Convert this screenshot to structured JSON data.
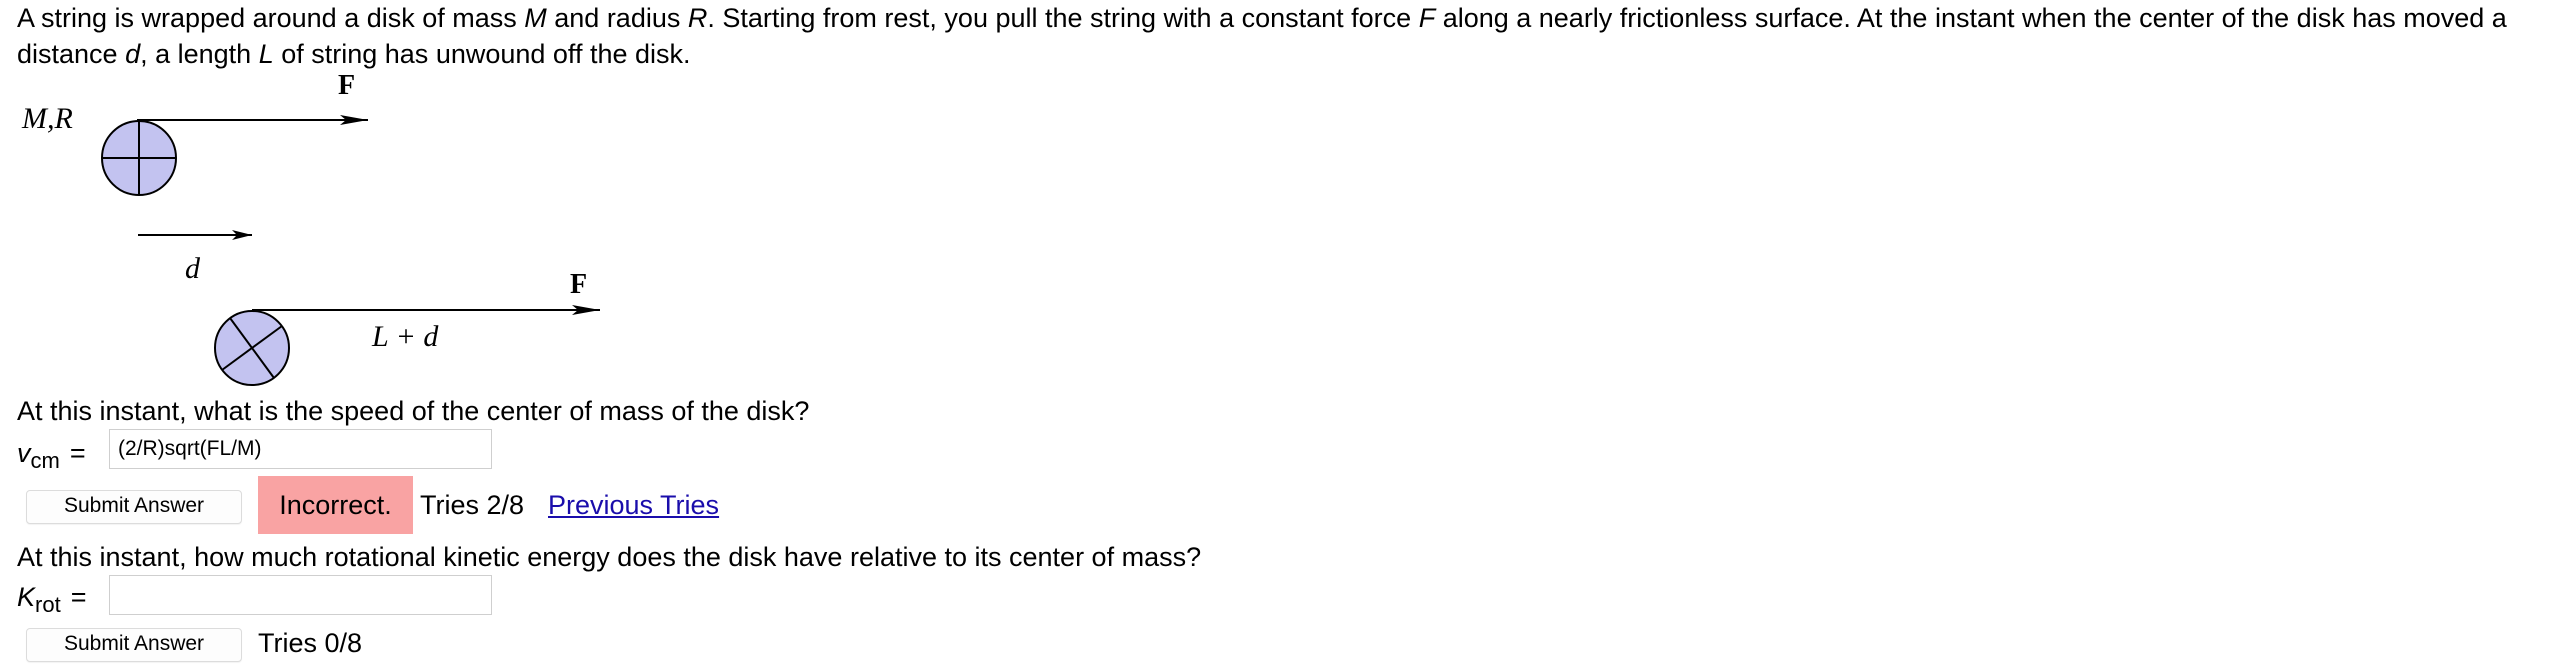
{
  "problem": {
    "p1": "A string is wrapped around a disk of mass ",
    "M": "M",
    "p2": " and radius ",
    "R": "R",
    "p3": ". Starting from rest, you pull the string with a constant force ",
    "F": "F",
    "p4": " along a nearly frictionless surface. At the instant when the center of the disk has moved a distance ",
    "d": "d",
    "p5": ", a length ",
    "L": "L",
    "p6": " of string has unwound off the disk."
  },
  "diagram": {
    "label_mr": "M,R",
    "label_f_top": "F",
    "label_d": "d",
    "label_f_bottom": "F",
    "label_ld": "L + d",
    "disk_color": "#c3c3f0"
  },
  "question1": {
    "prompt": "At this instant, what is the speed of the center of mass of the disk?",
    "var_symbol": "v",
    "var_sub": "cm",
    "eq": "=",
    "input_value": "(2/R)sqrt(FL/M)",
    "submit_label": "Submit Answer",
    "feedback": "Incorrect.",
    "tries": "Tries 2/8",
    "previous_link": "Previous Tries",
    "feedback_color": "#f9a3a3"
  },
  "question2": {
    "prompt": "At this instant, how much rotational kinetic energy does the disk have relative to its center of mass?",
    "var_symbol": "K",
    "var_sub": "rot",
    "eq": "=",
    "input_value": "",
    "submit_label": "Submit Answer",
    "tries": "Tries 0/8"
  }
}
